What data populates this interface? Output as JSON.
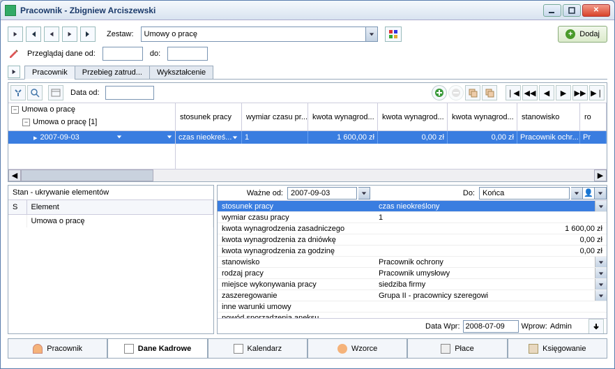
{
  "window": {
    "title": "Pracownik - Zbigniew Arciszewski"
  },
  "toolbar1": {
    "zestaw_label": "Zestaw:",
    "zestaw_value": "Umowy o pracę",
    "add_label": "Dodaj"
  },
  "toolbar2": {
    "browse_label": "Przeglądaj dane od:",
    "do_label": "do:",
    "from_value": "",
    "to_value": ""
  },
  "smalltabs": {
    "t1": "Pracownik",
    "t2": "Przebieg zatrud...",
    "t3": "Wykształcenie"
  },
  "grid": {
    "data_od_label": "Data od:",
    "data_od_value": "",
    "tree": {
      "root": "Umowa o pracę",
      "child": "Umowa o pracę [1]",
      "leaf": "2007-09-03"
    },
    "columns": [
      "stosunek pracy",
      "wymiar czasu pr...",
      "kwota wynagrod...",
      "kwota wynagrod...",
      "kwota wynagrod...",
      "stanowisko",
      "ro"
    ],
    "row": {
      "c0": "czas nieokreś...",
      "c1": "1",
      "c2": "1 600,00 zł",
      "c3": "0,00 zł",
      "c4": "0,00 zł",
      "c5": "Pracownik ochr...",
      "c6": "Pr"
    }
  },
  "leftpanel": {
    "title": "Stan - ukrywanie elementów",
    "col_s": "S",
    "col_elem": "Element",
    "rows": [
      "Umowa o pracę"
    ]
  },
  "rightpanel": {
    "wazne_od_label": "Ważne od:",
    "wazne_od_value": "2007-09-03",
    "do_label": "Do:",
    "do_value": "Końca",
    "props": [
      {
        "k": "stosunek pracy",
        "v": "czas nieokreślony",
        "sel": true,
        "dd": true
      },
      {
        "k": "wymiar czasu pracy",
        "v": "1"
      },
      {
        "k": "kwota wynagrodzenia zasadniczego",
        "v": "1 600,00 zł",
        "r": true
      },
      {
        "k": "kwota wynagrodzenia za dniówkę",
        "v": "0,00 zł",
        "r": true
      },
      {
        "k": "kwota wynagrodzenia za godzinę",
        "v": "0,00 zł",
        "r": true
      },
      {
        "k": "stanowisko",
        "v": "Pracownik ochrony",
        "dd": true
      },
      {
        "k": "rodzaj pracy",
        "v": "Pracownik umysłowy",
        "dd": true
      },
      {
        "k": "miejsce wykonywania pracy",
        "v": "siedziba firmy",
        "dd": true
      },
      {
        "k": "zaszeregowanie",
        "v": "Grupa II - pracownicy szeregowi",
        "dd": true
      },
      {
        "k": "inne warunki umowy",
        "v": ""
      },
      {
        "k": "powód sporządzenia aneksu",
        "v": ""
      }
    ],
    "footer": {
      "data_wpr_label": "Data Wpr:",
      "data_wpr_value": "2008-07-09",
      "wprow_label": "Wprow:",
      "wprow_value": "Admin"
    }
  },
  "maintabs": {
    "t1": "Pracownik",
    "t2": "Dane Kadrowe",
    "t3": "Kalendarz",
    "t4": "Wzorce",
    "t5": "Płace",
    "t6": "Księgowanie"
  }
}
